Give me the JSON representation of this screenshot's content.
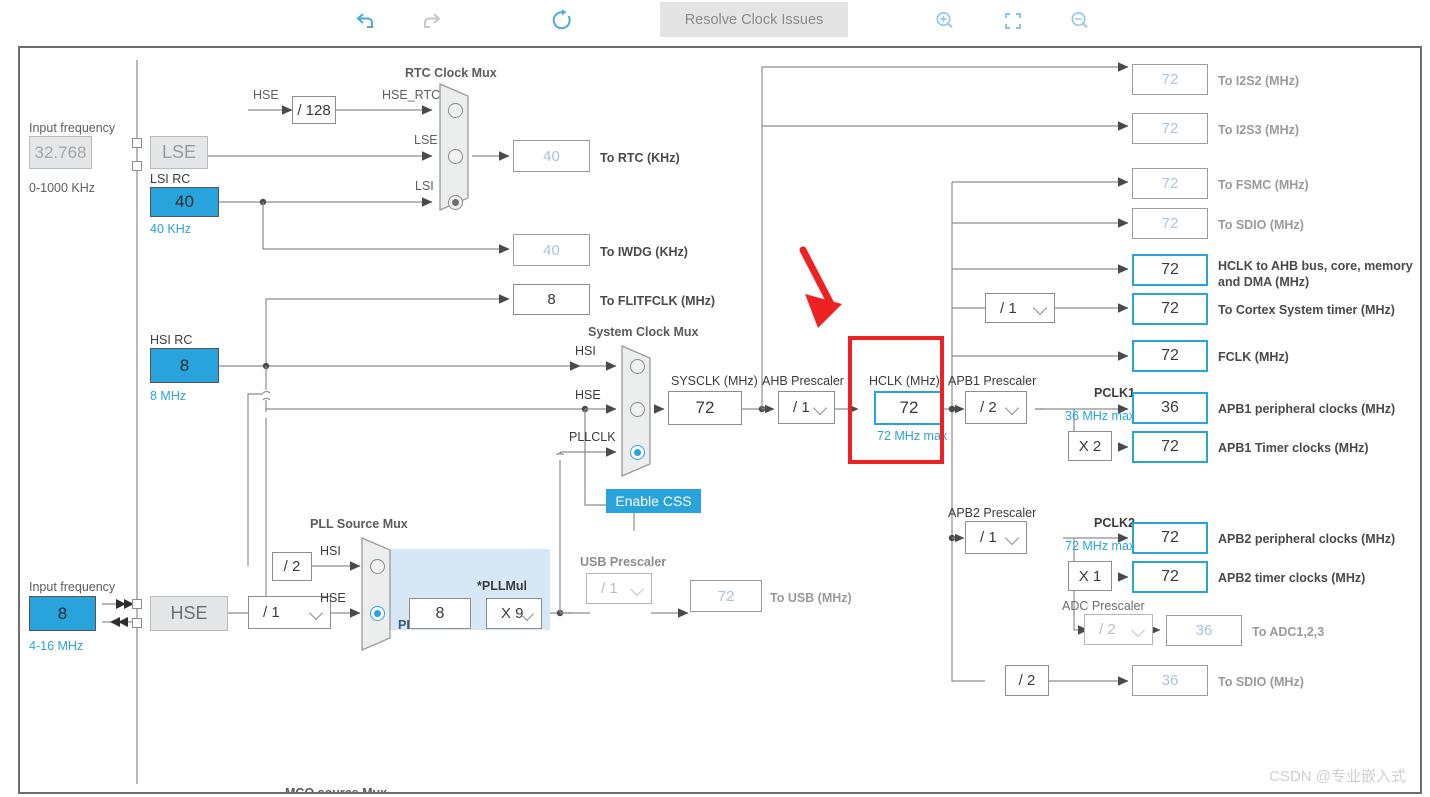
{
  "toolbar": {
    "undo_icon": "undo-icon",
    "redo_icon": "redo-icon",
    "reset_icon": "reset-icon",
    "resolve_label": "Resolve Clock Issues",
    "zoom_in_icon": "zoom-in-icon",
    "fit_icon": "fit-to-screen-icon",
    "zoom_out_icon": "zoom-out-icon"
  },
  "lse": {
    "input_frequency_label": "Input frequency",
    "value": "32.768",
    "range": "0-1000 KHz",
    "name": "LSE"
  },
  "lsi": {
    "title": "LSI RC",
    "value": "40",
    "unit": "40 KHz"
  },
  "hsi": {
    "title": "HSI RC",
    "value": "8",
    "unit": "8 MHz"
  },
  "hse": {
    "input_frequency_label": "Input frequency",
    "value": "8",
    "range": "4-16 MHz",
    "name": "HSE",
    "divider": "/ 1"
  },
  "rtc_mux": {
    "title": "RTC Clock Mux",
    "hse_label": "HSE",
    "hse_div": "/ 128",
    "hse_rtc_label": "HSE_RTC",
    "lse_label": "LSE",
    "lsi_label": "LSI",
    "selected": "LSI"
  },
  "outputs_left": [
    {
      "value": "40",
      "label": "To RTC (KHz)",
      "state": "disabled"
    },
    {
      "value": "40",
      "label": "To IWDG (KHz)",
      "state": "disabled"
    },
    {
      "value": "8",
      "label": "To FLITFCLK (MHz)",
      "state": "enabled"
    }
  ],
  "system_clock_mux": {
    "title": "System Clock Mux",
    "hsi_label": "HSI",
    "hse_label": "HSE",
    "pllclk_label": "PLLCLK",
    "selected": "PLLCLK"
  },
  "enable_css": {
    "label": "Enable CSS"
  },
  "sysclk": {
    "title": "SYSCLK (MHz)",
    "value": "72"
  },
  "ahb_prescaler": {
    "title": "AHB Prescaler",
    "value": "/ 1"
  },
  "hclk": {
    "title": "HCLK (MHz)",
    "value": "72",
    "max": "72 MHz max"
  },
  "pll_source_mux": {
    "title": "PLL Source Mux",
    "hsi_div": "/ 2",
    "hsi_label": "HSI",
    "hse_label": "HSE",
    "selected": "HSE"
  },
  "pll": {
    "region_label": "PLL",
    "input_value": "8",
    "pllmul_title": "*PLLMul",
    "pllmul_value": "X 9"
  },
  "usb": {
    "prescaler_title": "USB Prescaler",
    "prescaler_value": "/ 1",
    "value": "72",
    "label": "To USB (MHz)"
  },
  "apb1": {
    "prescaler_title": "APB1 Prescaler",
    "prescaler_value": "/ 2",
    "pclk_label": "PCLK1",
    "max": "36 MHz max",
    "multiplier": "X 2",
    "periph_value": "36",
    "periph_label": "APB1 peripheral clocks (MHz)",
    "timer_value": "72",
    "timer_label": "APB1 Timer clocks (MHz)"
  },
  "apb2": {
    "prescaler_title": "APB2 Prescaler",
    "prescaler_value": "/ 1",
    "pclk_label": "PCLK2",
    "max": "72 MHz max",
    "multiplier": "X 1",
    "periph_value": "72",
    "periph_label": "APB2 peripheral clocks (MHz)",
    "timer_value": "72",
    "timer_label": "APB2 timer clocks (MHz)"
  },
  "adc": {
    "prescaler_title": "ADC Prescaler",
    "prescaler_value": "/ 2",
    "value": "36",
    "label": "To ADC1,2,3"
  },
  "sdio_bottom": {
    "divider": "/ 2",
    "value": "36",
    "label": "To SDIO (MHz)"
  },
  "outputs_right": [
    {
      "value": "72",
      "label": "To I2S2 (MHz)",
      "state": "disabled"
    },
    {
      "value": "72",
      "label": "To I2S3 (MHz)",
      "state": "disabled"
    },
    {
      "value": "72",
      "label": "To FSMC (MHz)",
      "state": "disabled"
    },
    {
      "value": "72",
      "label": "To SDIO (MHz)",
      "state": "disabled"
    },
    {
      "value": "72",
      "label": "HCLK to AHB bus, core, memory and DMA (MHz)",
      "state": "active"
    },
    {
      "value": "72",
      "label": "To Cortex System timer (MHz)",
      "state": "active"
    },
    {
      "value": "72",
      "label": "FCLK (MHz)",
      "state": "active"
    }
  ],
  "cortex_prescaler": {
    "value": "/ 1"
  },
  "mco": {
    "title": "MCO source Mux"
  },
  "watermark": {
    "text": "CSDN @专业嵌入式"
  },
  "colors": {
    "accent": "#29a3dc",
    "highlight": "#ee2222",
    "source_fill": "#29a3dc",
    "pll_region": "#d6e8f5",
    "wire": "#8d8d8d"
  }
}
